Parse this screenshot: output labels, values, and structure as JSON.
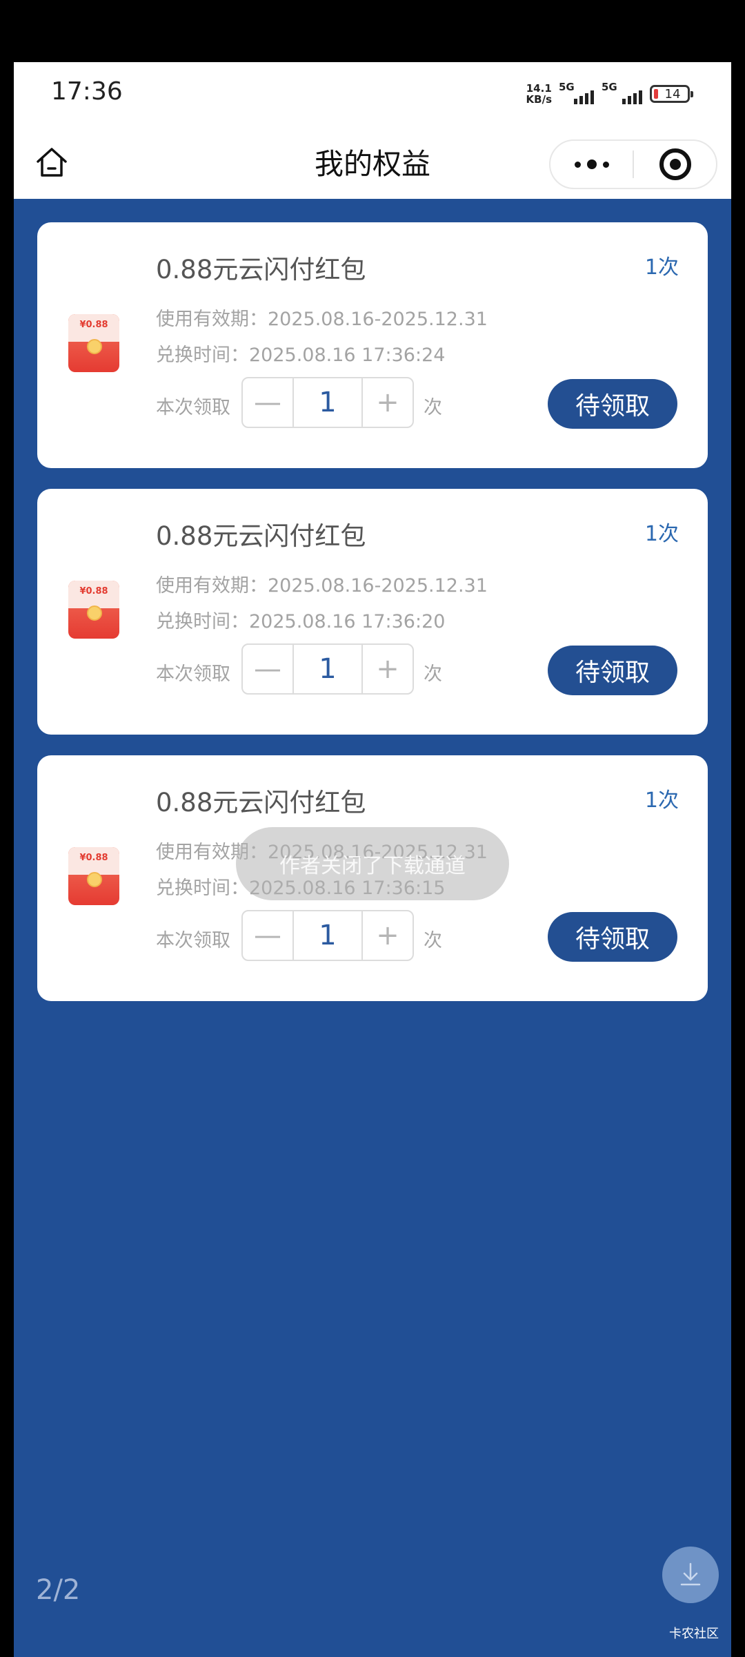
{
  "status": {
    "time": "17:36",
    "speed_value": "14.1",
    "speed_unit": "KB/s",
    "sim1": "5G",
    "sim2": "5G",
    "battery": "14"
  },
  "nav": {
    "title": "我的权益",
    "icons": [
      "home-icon",
      "more-icon",
      "close-target-icon"
    ]
  },
  "cards": [
    {
      "title": "0.88元云闪付红包",
      "count": "1次",
      "badge": "¥0.88",
      "valid": "使用有效期：2025.08.16-2025.12.31",
      "time": "兑换时间：2025.08.16 17:36:24",
      "qty_label": "本次领取",
      "minus": "—",
      "qty": "1",
      "plus": "+",
      "qty_unit": "次",
      "action": "待领取"
    },
    {
      "title": "0.88元云闪付红包",
      "count": "1次",
      "badge": "¥0.88",
      "valid": "使用有效期：2025.08.16-2025.12.31",
      "time": "兑换时间：2025.08.16 17:36:20",
      "qty_label": "本次领取",
      "minus": "—",
      "qty": "1",
      "plus": "+",
      "qty_unit": "次",
      "action": "待领取"
    },
    {
      "title": "0.88元云闪付红包",
      "count": "1次",
      "badge": "¥0.88",
      "valid": "使用有效期：2025.08.16-2025.12.31",
      "time": "兑换时间：2025.08.16 17:36:15",
      "qty_label": "本次领取",
      "minus": "—",
      "qty": "1",
      "plus": "+",
      "qty_unit": "次",
      "action": "待领取"
    }
  ],
  "toast": "作者关闭了下载通道",
  "pager": "2/2",
  "watermark": "卡农社区",
  "colors": {
    "page_bg": "#214f95",
    "accent": "#234f92",
    "count_text": "#2b68b0"
  }
}
